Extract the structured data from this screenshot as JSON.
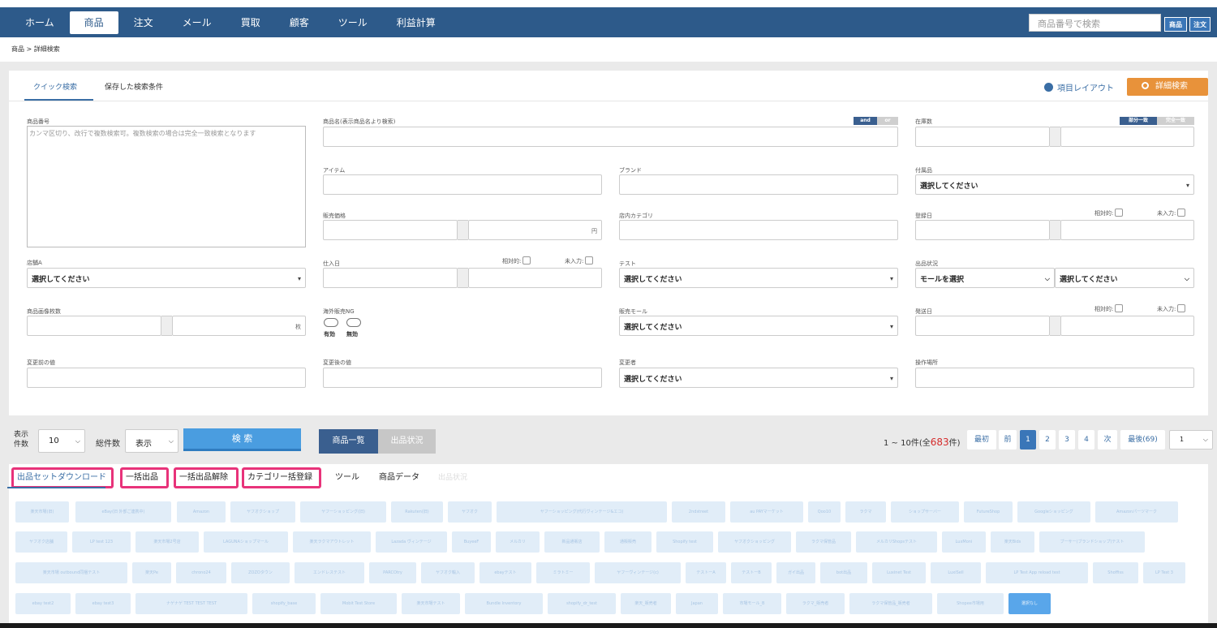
{
  "nav": {
    "items": [
      "ホーム",
      "商品",
      "注文",
      "メール",
      "買取",
      "顧客",
      "ツール",
      "利益計算"
    ],
    "active_index": 1,
    "search_placeholder": "商品番号で検索",
    "btn_product": "商品",
    "btn_order": "注文"
  },
  "breadcrumb": "商品 > 詳細検索",
  "tabs": {
    "quick": "クイック検索",
    "saved": "保存した検索条件"
  },
  "layout_link": "項目レイアウト",
  "advanced_button": "詳細検索",
  "form": {
    "product_no": {
      "label": "商品番号",
      "placeholder": "カンマ区切り、改行で複数検索可。複数検索の場合は完全一致検索となります"
    },
    "product_name": {
      "label": "商品名(表示商品名より検索)",
      "and": "and",
      "or": "or"
    },
    "stock": {
      "label": "在庫数",
      "partial": "部分一致",
      "exact": "完全一致"
    },
    "item": {
      "label": "アイテム"
    },
    "brand": {
      "label": "ブランド"
    },
    "accessory": {
      "label": "付属品",
      "value": "選択してください"
    },
    "price": {
      "label": "販売価格",
      "unit": "円"
    },
    "store_category": {
      "label": "店内カテゴリ"
    },
    "register_date": {
      "label": "登録日"
    },
    "relative": "相対的:",
    "not_input": "未入力:",
    "store_a": {
      "label": "店舗A",
      "value": "選択してください"
    },
    "purchase_date": {
      "label": "仕入日"
    },
    "test": {
      "label": "テスト",
      "value": "選択してください"
    },
    "listing_status": {
      "label": "出品状況",
      "mall": "モールを選択",
      "value": "選択してください"
    },
    "image_count": {
      "label": "商品画像枚数",
      "unit": "枚"
    },
    "overseas_ng": {
      "label": "海外販売NG",
      "valid": "有効",
      "invalid": "無効"
    },
    "sales_mall": {
      "label": "販売モール",
      "value": "選択してください"
    },
    "ship_date": {
      "label": "発送日"
    },
    "before_value": {
      "label": "変更前の値"
    },
    "after_value": {
      "label": "変更後の値"
    },
    "changer": {
      "label": "変更者",
      "value": "選択してください"
    },
    "operation_place": {
      "label": "操作場所"
    }
  },
  "controls": {
    "display_count_label": "表示件数",
    "display_count_value": "10",
    "total_label": "総件数",
    "total_value": "表示",
    "search": "検 索",
    "list_tab": "商品一覧",
    "status_tab": "出品状況",
    "result_prefix": "1 ~ 10件(全",
    "result_total": "683",
    "result_suffix": "件)",
    "pager": [
      "最初",
      "前",
      "1",
      "2",
      "3",
      "4",
      "次",
      "最後(69)"
    ],
    "page_select": "1"
  },
  "toolbar": {
    "items": [
      "出品セットダウンロード",
      "一括出品",
      "一括出品解除",
      "カテゴリー括登録",
      "ツール",
      "商品データ",
      "出品状況"
    ]
  },
  "chips": [
    [
      "楽天市場(旧)",
      "eBay(旧 外部ご連携中)",
      "Amazon",
      "ヤフオクショップ",
      "ヤフーショッピング(旧)",
      "Rakuten(旧)",
      "ヤフオク",
      "ヤフーショッピング(代行ヴィンテージ&エコ)",
      "2ndstreet",
      "au PAYマーケット",
      "Qoo10",
      "ラクマ",
      "ショップサーバー",
      "FutureShop",
      "Googleショッピング",
      "Amazonパーツマーク"
    ],
    [
      "ヤフオク店舗",
      "LP test 123",
      "楽天市場2号店",
      "LAGUNAショップマール",
      "楽天ラクマアウトレット",
      "Lazada ヴィンテージ",
      "BuyeeF",
      "メルカリ",
      "新品通販店",
      "通販販売",
      "Shopify test",
      "ヤフオクショッピング",
      "ラクマ保管品",
      "メルカリShopsテスト",
      "LuxMoni",
      "楽天Bids",
      "ブーサー(ブランドショップ)テスト"
    ],
    [
      "楽天市場 outbound同梱テスト",
      "楽天Pe",
      "chrono24",
      "ZOZOタウン",
      "エンドレステスト",
      "PARCOtry",
      "ヤフオク輸入",
      "ebayテスト",
      "ミラトミー",
      "ヤフーヴィンテージ(c)",
      "テストーA",
      "テストーB",
      "ガイ出品",
      "bot出品",
      "Luxinet Test",
      "LuxiSell",
      "LP Test App reload test",
      "Shoffiss",
      "LP Test 3"
    ],
    [
      "ebay test2",
      "ebay test3",
      "ナゲナゲ TEST TEST TEST",
      "shopify_base",
      "Mobit Test Store",
      "楽天市場テスト",
      "Bundle Inventory",
      "shopify_dr_test",
      "楽天_販売者",
      "Japan",
      "市場モール_B",
      "ラクマ_販売者",
      "ラクマ保管品_販売者",
      "Shopee市場用",
      "選択なし"
    ]
  ]
}
